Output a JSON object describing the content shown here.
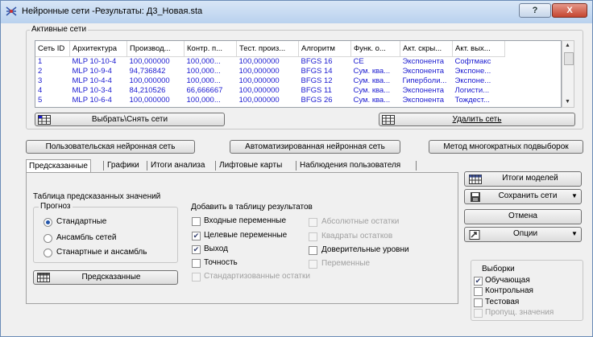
{
  "window": {
    "title": "Нейронные сети -Результаты: Д3_Новая.sta",
    "help_label": "?",
    "close_label": "X"
  },
  "active_nets": {
    "group_label": "Активные сети",
    "columns": [
      "Сеть ID",
      "Архитектура",
      "Производ...",
      "Контр. п...",
      "Тест. произ...",
      "Алгоритм",
      "Функ. о...",
      "Акт. скры...",
      "Акт. вых..."
    ],
    "rows": [
      [
        "1",
        "MLP 10-10-4",
        "100,000000",
        "100,000...",
        "100,000000",
        "BFGS 16",
        "CE",
        "Экспонента",
        "Софтмакс"
      ],
      [
        "2",
        "MLP 10-9-4",
        "94,736842",
        "100,000...",
        "100,000000",
        "BFGS 14",
        "Сум. ква...",
        "Экспонента",
        "Экспоне..."
      ],
      [
        "3",
        "MLP 10-4-4",
        "100,000000",
        "100,000...",
        "100,000000",
        "BFGS 12",
        "Сум. ква...",
        "Гиперболи...",
        "Экспоне..."
      ],
      [
        "4",
        "MLP 10-3-4",
        "84,210526",
        "66,666667",
        "100,000000",
        "BFGS 11",
        "Сум. ква...",
        "Экспонента",
        "Логисти..."
      ],
      [
        "5",
        "MLP 10-6-4",
        "100,000000",
        "100,000...",
        "100,000000",
        "BFGS 26",
        "Сум. ква...",
        "Экспонента",
        "Тождест..."
      ]
    ],
    "select_button": "Выбрать\\Снять сети",
    "delete_button": "Удалить сеть"
  },
  "modes": {
    "custom": "Пользовательская нейронная сеть",
    "automated": "Автоматизированная нейронная сеть",
    "resampling": "Метод многократных подвыборок"
  },
  "tabs": [
    "Предсказанные",
    "Графики",
    "Итоги анализа",
    "Лифтовые карты",
    "Наблюдения пользователя"
  ],
  "predicted": {
    "table_label": "Таблица предсказанных значений",
    "forecast": {
      "label": "Прогноз",
      "options": [
        {
          "label": "Стандартные",
          "selected": true
        },
        {
          "label": "Ансамбль сетей",
          "selected": false
        },
        {
          "label": "Станартные и ансамбль",
          "selected": false
        }
      ]
    },
    "add_to_table": {
      "label": "Добавить в таблицу результатов",
      "left": [
        {
          "label": "Входные переменные",
          "checked": false,
          "enabled": true
        },
        {
          "label": "Целевые переменные",
          "checked": true,
          "enabled": true
        },
        {
          "label": "Выход",
          "checked": true,
          "enabled": true
        },
        {
          "label": "Точность",
          "checked": false,
          "enabled": true
        },
        {
          "label": "Стандартизованные остатки",
          "checked": false,
          "enabled": false
        }
      ],
      "right": [
        {
          "label": "Абсолютные остатки",
          "checked": false,
          "enabled": false
        },
        {
          "label": "Квадраты остатков",
          "checked": false,
          "enabled": false
        },
        {
          "label": "Доверительные уровни",
          "checked": false,
          "enabled": true
        },
        {
          "label": "Переменные",
          "checked": false,
          "enabled": false
        }
      ]
    },
    "predicted_button": "Предсказанные"
  },
  "side": {
    "summary_button": "Итоги моделей",
    "save_button": "Сохранить сети",
    "cancel_button": "Отмена",
    "options_button": "Опции"
  },
  "samples": {
    "label": "Выборки",
    "items": [
      {
        "label": "Обучающая",
        "checked": true,
        "enabled": true
      },
      {
        "label": "Контрольная",
        "checked": false,
        "enabled": true
      },
      {
        "label": "Тестовая",
        "checked": false,
        "enabled": true
      },
      {
        "label": "Пропущ. значения",
        "checked": false,
        "enabled": false
      }
    ]
  },
  "colors": {
    "cell_text": "#1b1bd0",
    "radio_dot": "#2255aa"
  }
}
